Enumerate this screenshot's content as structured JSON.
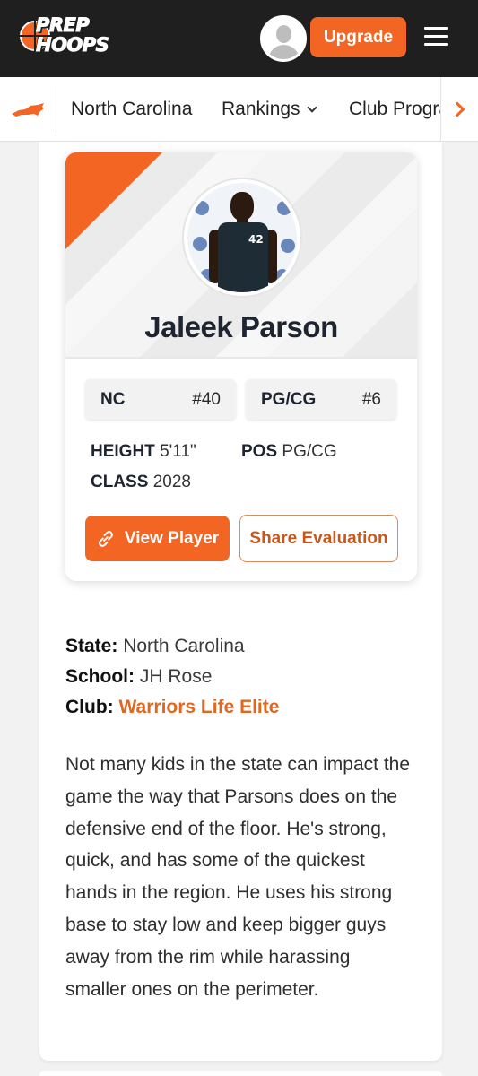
{
  "header": {
    "logo_line1": "PREP",
    "logo_line2": "HOOPS",
    "upgrade_label": "Upgrade"
  },
  "nav": {
    "items": [
      {
        "label": "North Carolina"
      },
      {
        "label": "Rankings"
      },
      {
        "label": "Club Progra"
      }
    ]
  },
  "player": {
    "name": "Jaleek Parson",
    "jersey_number": "42",
    "state_rank": {
      "label": "NC",
      "value": "#40"
    },
    "position_rank": {
      "label": "PG/CG",
      "value": "#6"
    },
    "height_label": "HEIGHT",
    "height_value": "5'11\"",
    "class_label": "CLASS",
    "class_value": "2028",
    "pos_label": "POS",
    "pos_value": "PG/CG",
    "view_label": "View Player",
    "share_label": "Share Evaluation"
  },
  "info": {
    "state_label": "State:",
    "state_value": "North Carolina",
    "school_label": "School:",
    "school_value": "JH Rose",
    "club_label": "Club:",
    "club_value": "Warriors Life Elite"
  },
  "evaluation": "Not many kids in the state can impact the game the way that Parsons does on the defensive end of the floor. He's strong, quick, and has some of the quickest hands in the region. He uses his strong base to stay low and keep bigger guys away from the rim while harassing smaller ones on the perimeter.",
  "colors": {
    "accent": "#f26522",
    "header_bg": "#1f1f1f",
    "club_link": "#e0671f"
  }
}
